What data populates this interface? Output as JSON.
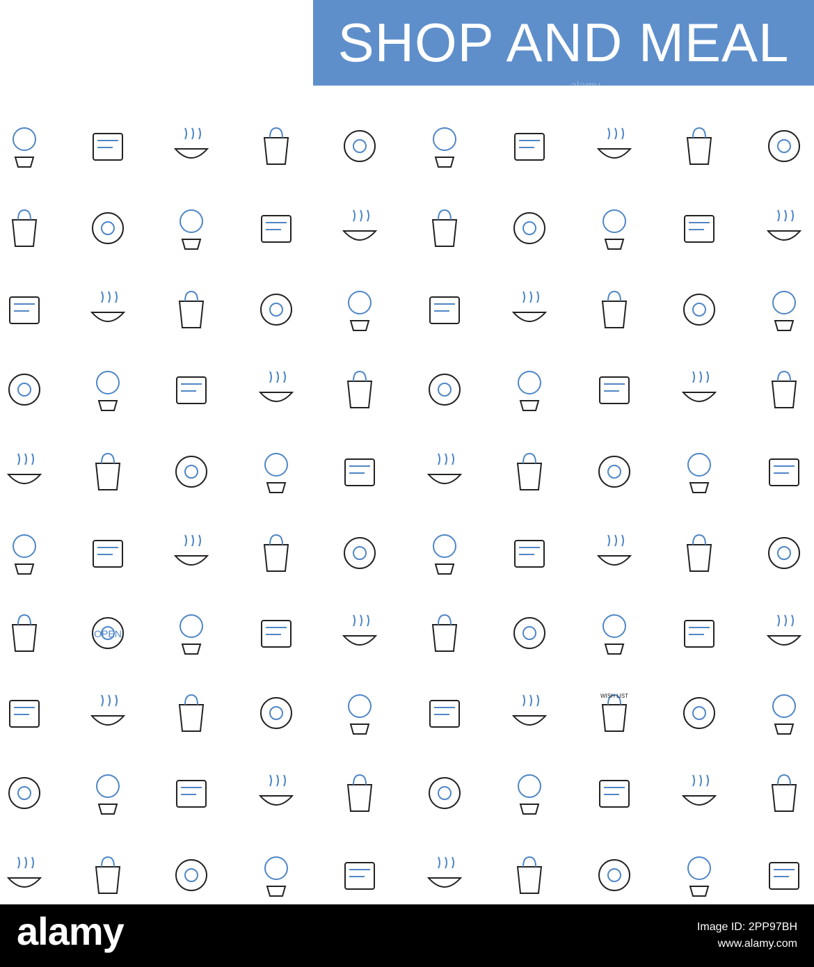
{
  "banner": {
    "title": "SHOP AND MEAL",
    "color": "#5e8fcb"
  },
  "watermark": "alamy",
  "footer": {
    "logo": "alamy",
    "image_id_text": "Image ID: 2PP97BH",
    "url_text": "www.alamy.com"
  },
  "icon_colors": {
    "dark": "#222222",
    "accent": "#4f86c6"
  },
  "icons": [
    [
      "lollipop-icon",
      "ice-cream-sundae-icon",
      "donut-icon",
      "macarons-stand-icon",
      "cake-slice-icon",
      "dinner-plate-icon",
      "fish-dish-icon",
      "restaurant-location-icon",
      "chef-icon",
      "cloche-icon"
    ],
    [
      "takeaway-bag-icon",
      "mushrooms-icon",
      "hot-bowl-icon",
      "sandwich-icon",
      "chef-hat-icon",
      "salad-bowl-icon",
      "ice-glass-icon",
      "toast-glasses-icon",
      "beer-bottle-icon",
      "beer-crate-icon"
    ],
    [
      "mobile-shopping-icon",
      "star-burst-icon",
      "email-monitor-icon",
      "tshirt-merch-icon",
      "office-desk-icon",
      "email-envelope-icon",
      "handshake-bag-icon",
      "product-boxes-icon",
      "online-payment-icon",
      "online-store-icon"
    ],
    [
      "mobile-payment-icon",
      "money-target-icon",
      "video-marketing-icon",
      "megaphone-icon",
      "quality-badge-icon",
      "market-stall-icon",
      "shopping-bag-hand-icon",
      "cash-money-icon",
      "pos-terminal-icon",
      "coupon-cut-icon"
    ],
    [
      "cash-register-icon",
      "ads-monitor-icon",
      "currency-exchange-icon",
      "card-atm-icon",
      "card-reader-icon",
      "product-review-icon",
      "package-box-icon",
      "money-bag-coins-icon",
      "cut-price-icon",
      "credit-card-icon"
    ],
    [
      "hand-scanner-icon",
      "storefront-icon",
      "gift-box-icon",
      "online-order-icon",
      "bag-settings-icon",
      "gift-hand-icon",
      "woman-shopper-icon",
      "clothes-shoes-icon",
      "hanging-clothes-icon",
      "woman-thumbs-up-icon"
    ],
    [
      "tshirt-icon",
      "open-sign-icon",
      "shopping-bags-icon",
      "gift-envelope-icon",
      "mail-icon",
      "hand-truck-icon",
      "discount-tag-icon",
      "gift-package-icon",
      "credit-cards-icon",
      "support-agent-icon"
    ],
    [
      "discount-coupon-icon",
      "money-bill-icon",
      "delivery-woman-icon",
      "discount-badge-icon",
      "coins-stack-icon",
      "web-basket-icon",
      "coat-icon",
      "wish-list-icon",
      "shopping-basket-icon",
      "tablet-phone-icon"
    ],
    [
      "coffee-machine-icon",
      "cocktail-glass-icon",
      "iced-drink-icon",
      "liquor-bottle-icon",
      "champagne-bucket-icon",
      "hurricane-cocktail-icon",
      "martini-icon",
      "margarita-icon",
      "ice-snifter-icon",
      "wine-glass-icon"
    ],
    [
      "chemex-icon",
      "latte-glass-icon",
      "coffee-grinder-icon",
      "coffee-cup-beans-icon",
      "coffee-to-go-icon",
      "coffee-carafe-icon",
      "kettle-icon",
      "teacup-icon",
      "cappuccino-icon",
      "takeaway-cup-icon"
    ]
  ],
  "wish_list_label": "WISH LIST",
  "open_sign_label": "OPEN"
}
